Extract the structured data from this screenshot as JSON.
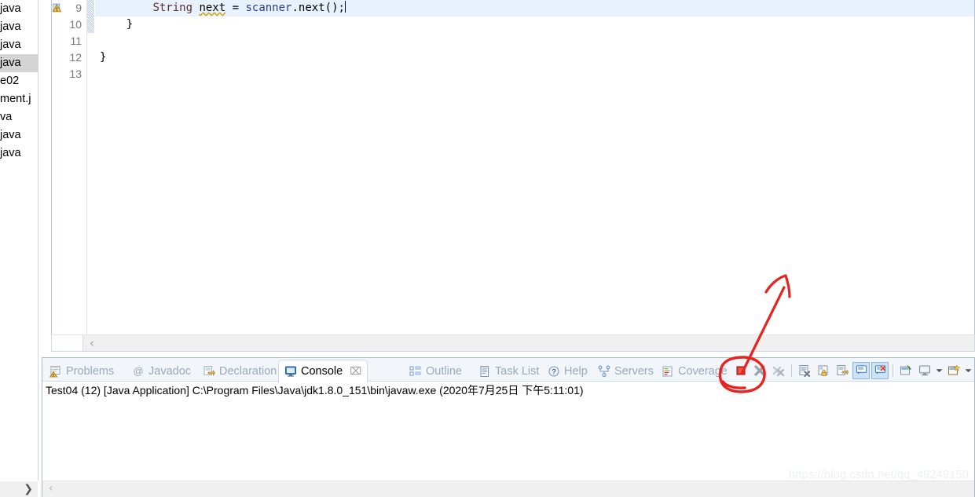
{
  "sidebar": {
    "items": [
      {
        "label": "java",
        "selected": false
      },
      {
        "label": "java",
        "selected": false
      },
      {
        "label": "java",
        "selected": false
      },
      {
        "label": "java",
        "selected": true
      },
      {
        "label": "e02",
        "selected": false
      },
      {
        "label": "ment.j",
        "selected": false
      },
      {
        "label": "va",
        "selected": false
      },
      {
        "label": "java",
        "selected": false
      },
      {
        "label": "java",
        "selected": false
      }
    ],
    "scroll_right_arrow": "❯"
  },
  "editor": {
    "line_numbers": [
      "9",
      "10",
      "11",
      "12",
      "13"
    ],
    "lines": [
      {
        "num": "9",
        "text": "        String next = scanner.next();",
        "highlighted": true
      },
      {
        "num": "10",
        "text": "    }",
        "highlighted": false
      },
      {
        "num": "11",
        "text": "",
        "highlighted": false
      },
      {
        "num": "12",
        "text": "}",
        "highlighted": false
      },
      {
        "num": "13",
        "text": "",
        "highlighted": false
      }
    ],
    "tokens_line9": {
      "indent": "        ",
      "type": "String",
      "space1": " ",
      "variable": "next",
      "operator": " = ",
      "object": "scanner",
      "dot": ".",
      "method": "next",
      "tail": "();"
    },
    "warning_marker_line": "9",
    "scroll_left_arrow": "‹"
  },
  "console_view": {
    "tabs": [
      {
        "label": "Problems",
        "icon": "problems-icon",
        "active": false
      },
      {
        "label": "Javadoc",
        "icon": "javadoc-icon",
        "active": false
      },
      {
        "label": "Declaration",
        "icon": "declaration-icon",
        "active": false
      },
      {
        "label": "Console",
        "icon": "console-icon",
        "active": true,
        "close": "⌧"
      },
      {
        "label": "Outline",
        "icon": "outline-icon",
        "active": false
      },
      {
        "label": "Task List",
        "icon": "tasklist-icon",
        "active": false
      },
      {
        "label": "Help",
        "icon": "help-icon",
        "active": false
      },
      {
        "label": "Servers",
        "icon": "servers-icon",
        "active": false
      },
      {
        "label": "Coverage",
        "icon": "coverage-icon",
        "active": false
      }
    ],
    "toolbar": [
      {
        "name": "terminate-button",
        "tooltip": "Terminate",
        "state": "enabled"
      },
      {
        "name": "remove-launch-button",
        "tooltip": "Remove Launch",
        "state": "enabled"
      },
      {
        "name": "remove-all-launches-button",
        "tooltip": "Remove All Terminated Launches",
        "state": "disabled"
      },
      {
        "name": "clear-console-button",
        "tooltip": "Clear Console",
        "state": "enabled"
      },
      {
        "name": "scroll-lock-button",
        "tooltip": "Scroll Lock",
        "state": "enabled"
      },
      {
        "name": "word-wrap-button",
        "tooltip": "Word Wrap",
        "state": "enabled"
      },
      {
        "name": "show-console-on-output-button",
        "tooltip": "Show Console When Standard Out Changes",
        "state": "toggled"
      },
      {
        "name": "show-console-on-error-button",
        "tooltip": "Show Console When Standard Error Changes",
        "state": "toggled"
      },
      {
        "name": "pin-console-button",
        "tooltip": "Pin Console",
        "state": "enabled"
      },
      {
        "name": "display-selected-console-button",
        "tooltip": "Display Selected Console",
        "state": "enabled"
      },
      {
        "name": "display-selected-console-dropdown",
        "tooltip": "Display Selected Console menu",
        "state": "enabled"
      },
      {
        "name": "open-console-button",
        "tooltip": "Open Console",
        "state": "enabled"
      },
      {
        "name": "open-console-dropdown",
        "tooltip": "Open Console menu",
        "state": "enabled"
      }
    ],
    "launch_line": "Test04 (12) [Java Application] C:\\Program Files\\Java\\jdk1.8.0_151\\bin\\javaw.exe (2020年7月25日 下午5:11:01)",
    "output": "",
    "scroll_left_arrow": "‹"
  },
  "annotation": {
    "type": "hand-drawn-red-marker",
    "color": "#e8231f",
    "shapes": [
      "circle-around-terminate-button",
      "arrow-pointing-up-right"
    ]
  },
  "watermark": {
    "text": "https://blog.csdn.net/qq_49249150",
    "color": "#eceff2"
  }
}
